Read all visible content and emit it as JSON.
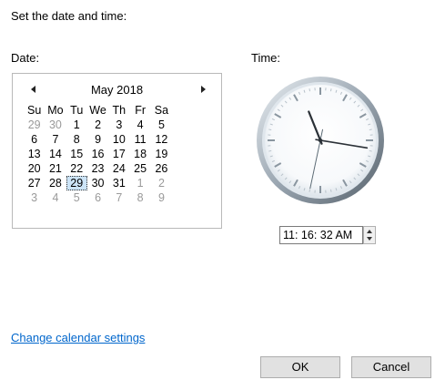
{
  "dialog": {
    "heading": "Set the date and time:",
    "date_label": "Date:",
    "time_label": "Time:"
  },
  "calendar": {
    "month_title": "May 2018",
    "weekdays": [
      "Su",
      "Mo",
      "Tu",
      "We",
      "Th",
      "Fr",
      "Sa"
    ],
    "weeks": [
      [
        {
          "d": "29",
          "o": true
        },
        {
          "d": "30",
          "o": true
        },
        {
          "d": "1"
        },
        {
          "d": "2"
        },
        {
          "d": "3"
        },
        {
          "d": "4"
        },
        {
          "d": "5"
        }
      ],
      [
        {
          "d": "6"
        },
        {
          "d": "7"
        },
        {
          "d": "8"
        },
        {
          "d": "9"
        },
        {
          "d": "10"
        },
        {
          "d": "11"
        },
        {
          "d": "12"
        }
      ],
      [
        {
          "d": "13"
        },
        {
          "d": "14"
        },
        {
          "d": "15"
        },
        {
          "d": "16"
        },
        {
          "d": "17"
        },
        {
          "d": "18"
        },
        {
          "d": "19"
        }
      ],
      [
        {
          "d": "20"
        },
        {
          "d": "21"
        },
        {
          "d": "22"
        },
        {
          "d": "23"
        },
        {
          "d": "24"
        },
        {
          "d": "25"
        },
        {
          "d": "26"
        }
      ],
      [
        {
          "d": "27"
        },
        {
          "d": "28"
        },
        {
          "d": "29",
          "sel": true
        },
        {
          "d": "30"
        },
        {
          "d": "31"
        },
        {
          "d": "1",
          "o": true
        },
        {
          "d": "2",
          "o": true
        }
      ],
      [
        {
          "d": "3",
          "o": true
        },
        {
          "d": "4",
          "o": true
        },
        {
          "d": "5",
          "o": true
        },
        {
          "d": "6",
          "o": true
        },
        {
          "d": "7",
          "o": true
        },
        {
          "d": "8",
          "o": true
        },
        {
          "d": "9",
          "o": true
        }
      ]
    ]
  },
  "clock": {
    "hour": 11,
    "minute": 16,
    "second": 32
  },
  "time_field": {
    "value": "11: 16: 32 AM"
  },
  "links": {
    "change_calendar": "Change calendar settings"
  },
  "buttons": {
    "ok": "OK",
    "cancel": "Cancel"
  }
}
